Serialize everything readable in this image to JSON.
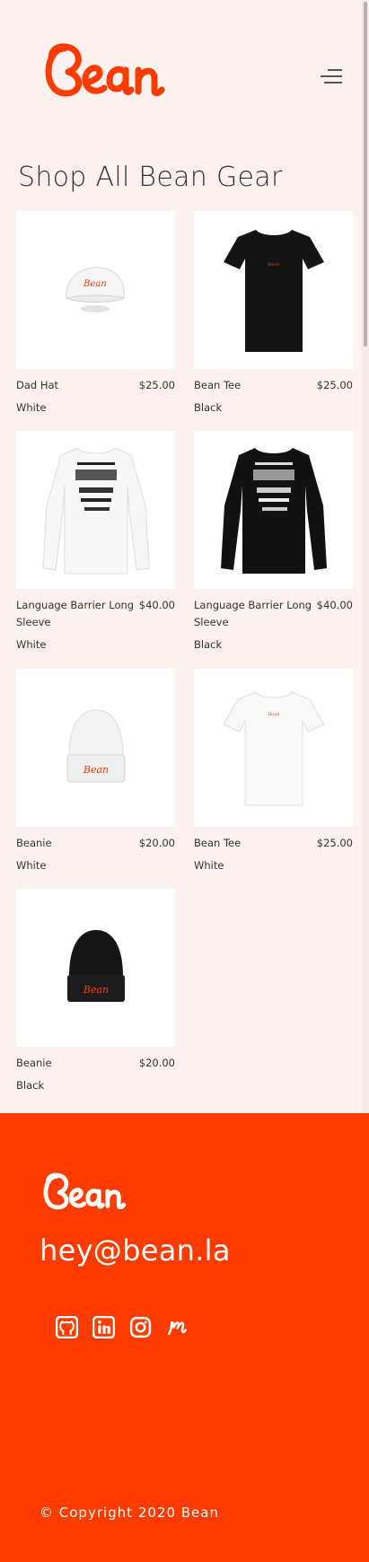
{
  "brand": {
    "name": "Bean",
    "color": "#ff3b00"
  },
  "header": {
    "menu_icon": "hamburger-menu-icon"
  },
  "page": {
    "title": "Shop All Bean Gear"
  },
  "products": [
    {
      "name": "Dad Hat",
      "price": "$25.00",
      "color": "White",
      "image": "white-dad-hat"
    },
    {
      "name": "Bean Tee",
      "price": "$25.00",
      "color": "Black",
      "image": "black-tee"
    },
    {
      "name": "Language Barrier Long Sleeve",
      "price": "$40.00",
      "color": "White",
      "image": "white-long-sleeve"
    },
    {
      "name": "Language Barrier Long Sleeve",
      "price": "$40.00",
      "color": "Black",
      "image": "black-long-sleeve"
    },
    {
      "name": "Beanie",
      "price": "$20.00",
      "color": "White",
      "image": "white-beanie"
    },
    {
      "name": "Bean Tee",
      "price": "$25.00",
      "color": "White",
      "image": "white-tee"
    },
    {
      "name": "Beanie",
      "price": "$20.00",
      "color": "Black",
      "image": "black-beanie"
    }
  ],
  "footer": {
    "email": "hey@bean.la",
    "social": [
      "github-icon",
      "linkedin-icon",
      "instagram-icon",
      "medium-icon"
    ],
    "copyright": "© Copyright 2020 Bean",
    "background": "#ff3b00"
  }
}
